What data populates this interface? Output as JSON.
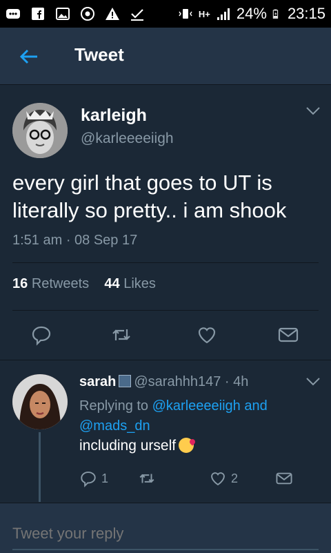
{
  "status_bar": {
    "battery": "24%",
    "time": "23:15",
    "network": "H+"
  },
  "header": {
    "title": "Tweet",
    "back_icon": "back-arrow-icon"
  },
  "tweet": {
    "author_name": "karleigh",
    "author_handle": "@karleeeeiigh",
    "text": "every girl that goes to UT is literally so pretty.. i am shook",
    "timestamp": "1:51 am · 08 Sep 17",
    "retweets_count": "16",
    "retweets_label": "Retweets",
    "likes_count": "44",
    "likes_label": "Likes"
  },
  "reply": {
    "author_name": "sarah",
    "author_handle": "@sarahhh147",
    "time": "· 4h",
    "replying_to_label": "Replying to",
    "mention_1": "@karleeeeiigh",
    "and_word": "and",
    "mention_2": "@mads_dn",
    "text": "including urself",
    "reply_count": "1",
    "like_count": "2"
  },
  "compose": {
    "placeholder": "Tweet your reply"
  },
  "colors": {
    "background": "#1b2836",
    "bar": "#243447",
    "accent": "#1da1f2",
    "muted": "#8899a6"
  }
}
